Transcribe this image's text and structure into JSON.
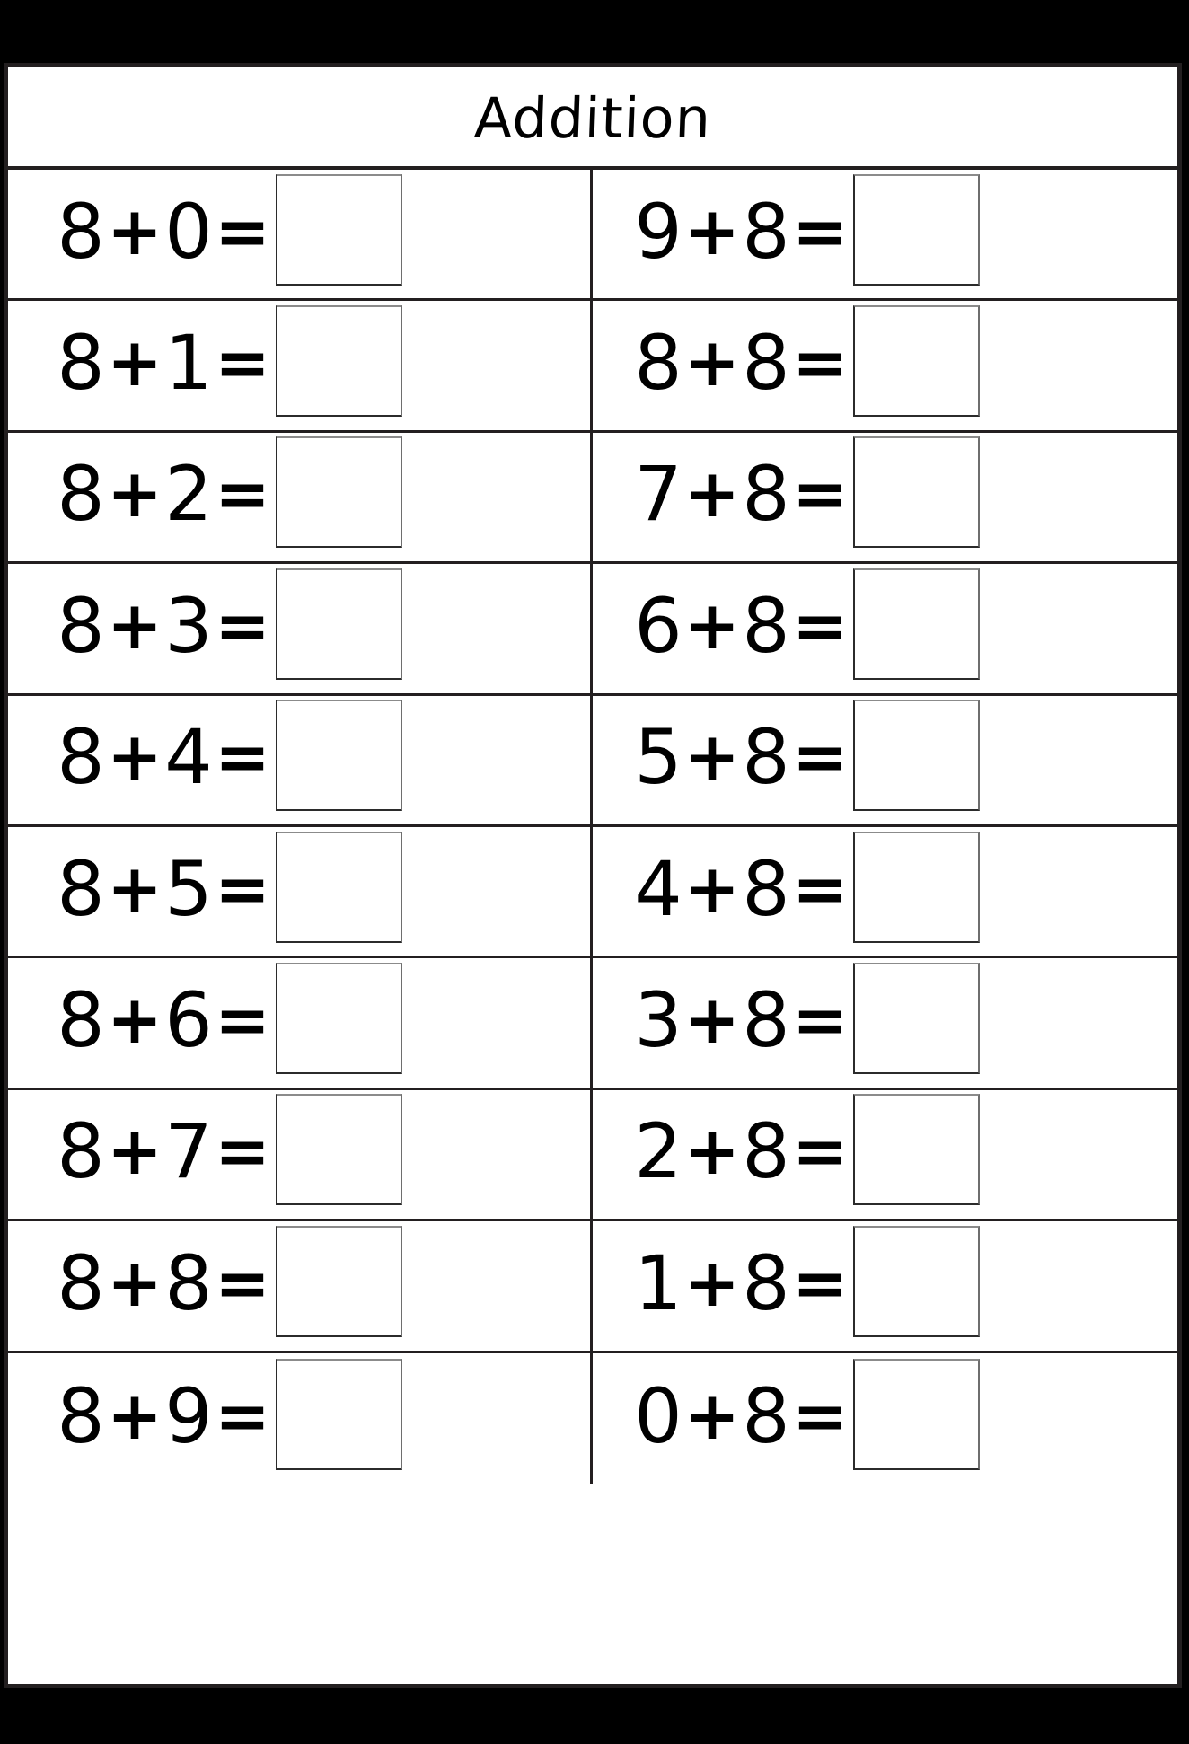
{
  "worksheet": {
    "title": "Addition",
    "operator": "+",
    "equals": "=",
    "answer_placeholder": "",
    "colors": {
      "page_background": "#000000",
      "sheet_background": "#ffffff",
      "grid_line": "#231f20",
      "text": "#000000",
      "answer_box_border": "#6e6e6e"
    },
    "columns": 2,
    "row_count": 10,
    "rows": [
      {
        "left": {
          "addend_1": "8",
          "addend_2": "0",
          "operator": "+",
          "equals": "=",
          "answer": ""
        },
        "right": {
          "addend_1": "9",
          "addend_2": "8",
          "operator": "+",
          "equals": "=",
          "answer": ""
        }
      },
      {
        "left": {
          "addend_1": "8",
          "addend_2": "1",
          "operator": "+",
          "equals": "=",
          "answer": ""
        },
        "right": {
          "addend_1": "8",
          "addend_2": "8",
          "operator": "+",
          "equals": "=",
          "answer": ""
        }
      },
      {
        "left": {
          "addend_1": "8",
          "addend_2": "2",
          "operator": "+",
          "equals": "=",
          "answer": ""
        },
        "right": {
          "addend_1": "7",
          "addend_2": "8",
          "operator": "+",
          "equals": "=",
          "answer": ""
        }
      },
      {
        "left": {
          "addend_1": "8",
          "addend_2": "3",
          "operator": "+",
          "equals": "=",
          "answer": ""
        },
        "right": {
          "addend_1": "6",
          "addend_2": "8",
          "operator": "+",
          "equals": "=",
          "answer": ""
        }
      },
      {
        "left": {
          "addend_1": "8",
          "addend_2": "4",
          "operator": "+",
          "equals": "=",
          "answer": ""
        },
        "right": {
          "addend_1": "5",
          "addend_2": "8",
          "operator": "+",
          "equals": "=",
          "answer": ""
        }
      },
      {
        "left": {
          "addend_1": "8",
          "addend_2": "5",
          "operator": "+",
          "equals": "=",
          "answer": ""
        },
        "right": {
          "addend_1": "4",
          "addend_2": "8",
          "operator": "+",
          "equals": "=",
          "answer": ""
        }
      },
      {
        "left": {
          "addend_1": "8",
          "addend_2": "6",
          "operator": "+",
          "equals": "=",
          "answer": ""
        },
        "right": {
          "addend_1": "3",
          "addend_2": "8",
          "operator": "+",
          "equals": "=",
          "answer": ""
        }
      },
      {
        "left": {
          "addend_1": "8",
          "addend_2": "7",
          "operator": "+",
          "equals": "=",
          "answer": ""
        },
        "right": {
          "addend_1": "2",
          "addend_2": "8",
          "operator": "+",
          "equals": "=",
          "answer": ""
        }
      },
      {
        "left": {
          "addend_1": "8",
          "addend_2": "8",
          "operator": "+",
          "equals": "=",
          "answer": ""
        },
        "right": {
          "addend_1": "1",
          "addend_2": "8",
          "operator": "+",
          "equals": "=",
          "answer": ""
        }
      },
      {
        "left": {
          "addend_1": "8",
          "addend_2": "9",
          "operator": "+",
          "equals": "=",
          "answer": ""
        },
        "right": {
          "addend_1": "0",
          "addend_2": "8",
          "operator": "+",
          "equals": "=",
          "answer": ""
        }
      }
    ]
  }
}
